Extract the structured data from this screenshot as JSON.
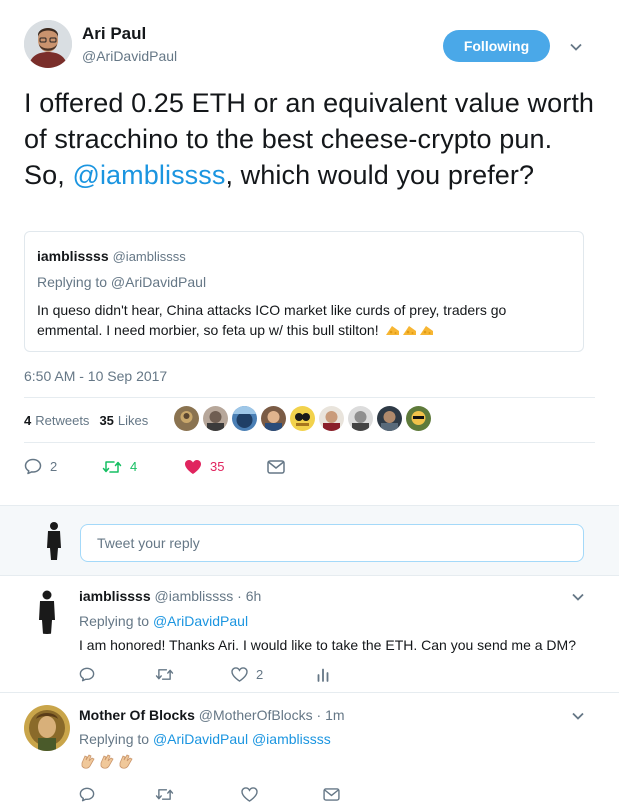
{
  "main_tweet": {
    "author_name": "Ari Paul",
    "author_handle": "@AriDavidPaul",
    "follow_label": "Following",
    "text_part1": "I offered 0.25 ETH or an equivalent value worth of stracchino to the best cheese-crypto pun.  So, ",
    "text_mention": "@iamblissss",
    "text_part2": ", which would you prefer?",
    "timestamp": "6:50 AM - 10 Sep 2017",
    "retweets_count": "4",
    "retweets_label": "Retweets",
    "likes_count": "35",
    "likes_label": "Likes",
    "reply_count": "2",
    "retweet_count_action": "4",
    "like_count_action": "35"
  },
  "quoted_tweet": {
    "name": "iamblissss",
    "handle": "@iamblissss",
    "replying_to": "Replying to @AriDavidPaul",
    "text": "In queso didn't hear, China attacks ICO market like curds of prey, traders go emmental. I need morbier, so feta up w/ this bull stilton!"
  },
  "reply_box": {
    "placeholder": "Tweet your reply"
  },
  "replies": [
    {
      "name": "iamblissss",
      "handle": "@iamblissss",
      "time": "6h",
      "replying_prefix": "Replying to ",
      "replying_to": "@AriDavidPaul",
      "text": "I am honored! Thanks Ari. I would like to take the ETH. Can you send me a DM?",
      "like_count": "2"
    },
    {
      "name": "Mother Of Blocks",
      "handle": "@MotherOfBlocks",
      "time": "1m",
      "replying_prefix": "Replying to ",
      "replying_to": "@AriDavidPaul @iamblissss",
      "text": ""
    }
  ],
  "colors": {
    "accent": "#1b95e0",
    "follow_bg": "#4aa8e8",
    "retweet_green": "#17bf63",
    "like_red": "#e0245e",
    "muted": "#657786"
  }
}
